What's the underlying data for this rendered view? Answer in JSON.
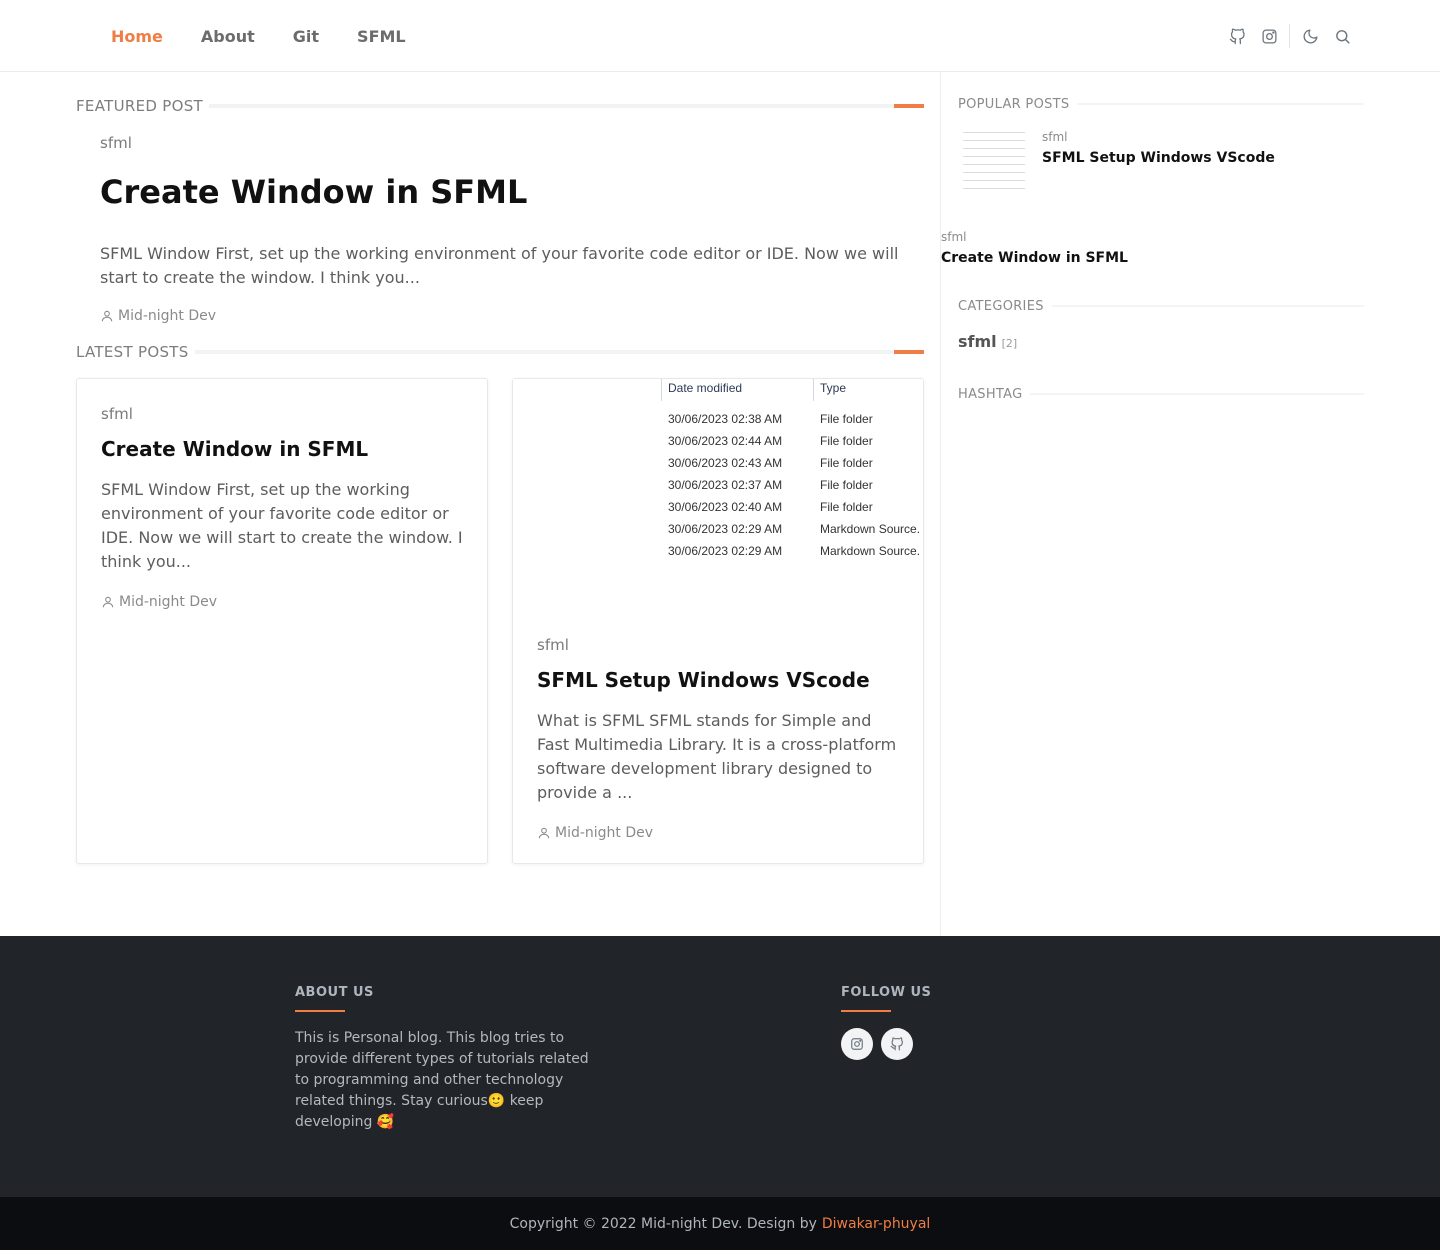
{
  "nav": {
    "items": [
      {
        "label": "Home",
        "active": true
      },
      {
        "label": "About",
        "active": false
      },
      {
        "label": "Git",
        "active": false
      },
      {
        "label": "SFML",
        "active": false
      }
    ],
    "icons": [
      "github-icon",
      "instagram-icon",
      "moon-icon",
      "search-icon"
    ]
  },
  "featured": {
    "section_label": "FEATURED POST",
    "tag": "sfml",
    "title": "Create Window in SFML",
    "excerpt": "SFML Window First, set up the working environment of your favorite code editor or IDE. Now we will start to create the window. I think you...",
    "author": "Mid-night Dev"
  },
  "latest": {
    "section_label": "LATEST POSTS",
    "posts": [
      {
        "tag": "sfml",
        "title": "Create Window in SFML",
        "excerpt": "SFML Window First, set up the working environment of your favorite code editor or IDE. Now we will start to create the window. I think you...",
        "author": "Mid-night Dev"
      },
      {
        "tag": "sfml",
        "title": "SFML Setup Windows VScode",
        "excerpt": "What is SFML SFML stands for Simple and Fast Multimedia Library. It is a cross-platform software development library designed to provide a ...",
        "author": "Mid-night Dev",
        "image": {
          "headers": [
            "Date modified",
            "Type"
          ],
          "rows": [
            [
              "30/06/2023 02:38 AM",
              "File folder"
            ],
            [
              "30/06/2023 02:44 AM",
              "File folder"
            ],
            [
              "30/06/2023 02:43 AM",
              "File folder"
            ],
            [
              "30/06/2023 02:37 AM",
              "File folder"
            ],
            [
              "30/06/2023 02:40 AM",
              "File folder"
            ],
            [
              "30/06/2023 02:29 AM",
              "Markdown Source."
            ],
            [
              "30/06/2023 02:29 AM",
              "Markdown Source."
            ]
          ]
        }
      }
    ]
  },
  "sidebar": {
    "popular_label": "POPULAR POSTS",
    "popular": [
      {
        "tag": "sfml",
        "title": "SFML Setup Windows VScode"
      },
      {
        "tag": "sfml",
        "title": "Create Window in SFML"
      }
    ],
    "categories_label": "CATEGORIES",
    "categories": [
      {
        "name": "sfml",
        "count": "[2]"
      }
    ],
    "hashtag_label": "HASHTAG"
  },
  "footer": {
    "about_title": "ABOUT US",
    "about_text": "This is Personal blog. This blog tries to provide different types of tutorials related to programming and other technology related things. Stay curious🙂 keep developing 🥰",
    "follow_title": "FOLLOW US",
    "social": [
      "instagram-icon",
      "github-icon"
    ],
    "copyright": "Copyright © 2022 Mid-night Dev. Design by",
    "designer": "Diwakar-phuyal"
  },
  "colors": {
    "accent": "#ef7d44",
    "footer_bg": "#212429",
    "copyright_bg": "#0c0d10"
  }
}
